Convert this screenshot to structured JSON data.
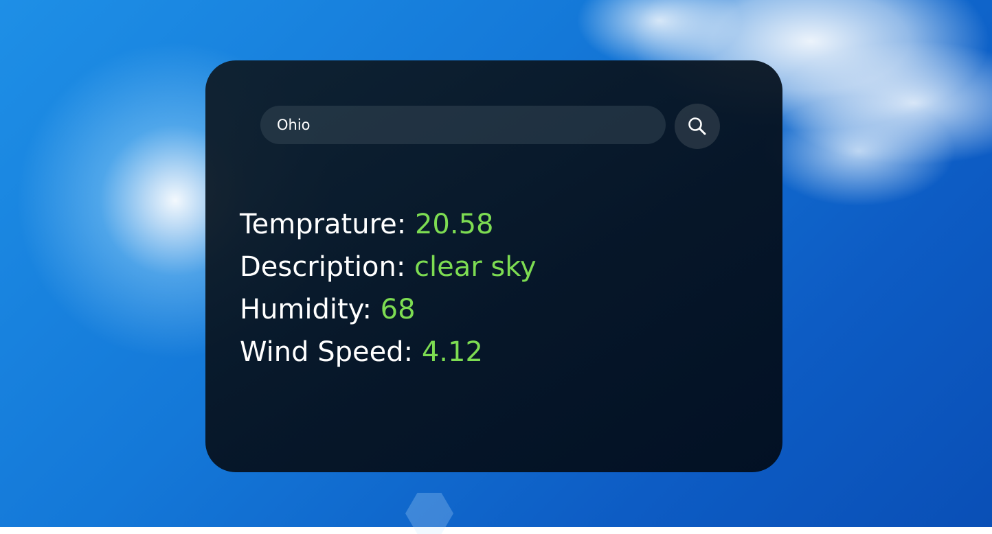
{
  "search": {
    "value": "Ohio",
    "icon": "search-icon"
  },
  "weather": [
    {
      "label": "Temprature: ",
      "value": "20.58"
    },
    {
      "label": "Description: ",
      "value": "clear sky"
    },
    {
      "label": "Humidity: ",
      "value": "68"
    },
    {
      "label": "Wind Speed: ",
      "value": "4.12"
    }
  ],
  "colors": {
    "value_accent": "#7ddc52",
    "card_background": "#07141f",
    "text": "#ffffff"
  }
}
